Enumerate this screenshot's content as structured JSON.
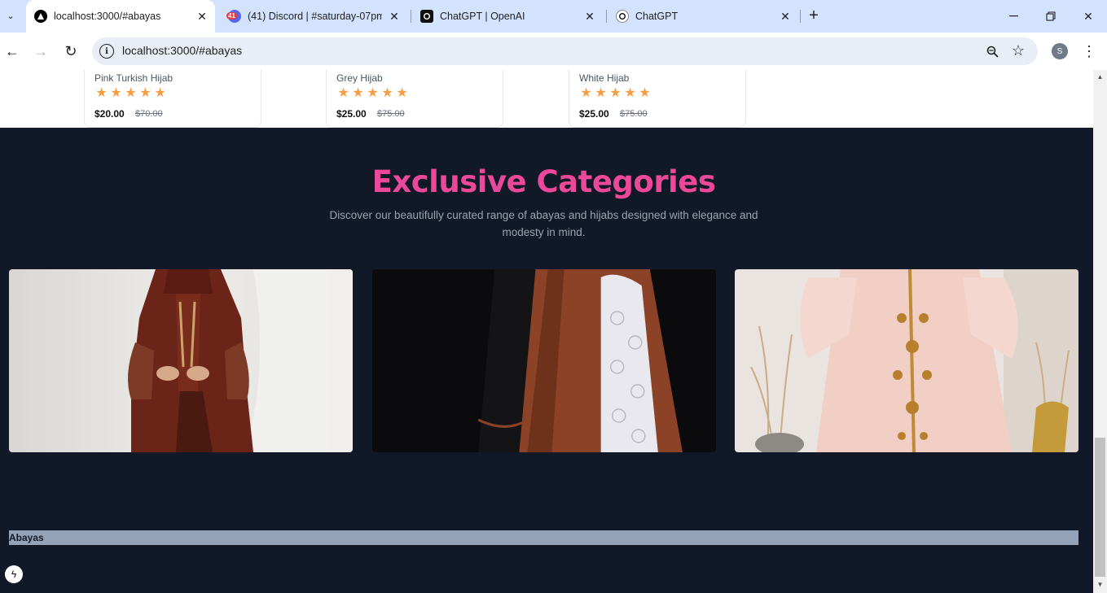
{
  "browser": {
    "tabs": [
      {
        "title": "localhost:3000/#abayas",
        "active": true
      },
      {
        "title": "(41) Discord | #saturday-07pm |",
        "badge": "41"
      },
      {
        "title": "ChatGPT | OpenAI"
      },
      {
        "title": "ChatGPT"
      }
    ],
    "url": "localhost:3000/#abayas",
    "profile_initial": "S"
  },
  "products": [
    {
      "name": "Pink Turkish Hijab",
      "price": "$20.00",
      "old_price": "$70.00",
      "rating": 5
    },
    {
      "name": "Grey Hijab",
      "price": "$25.00",
      "old_price": "$75.00",
      "rating": 5
    },
    {
      "name": "White Hijab",
      "price": "$25.00",
      "old_price": "$75.00",
      "rating": 5
    }
  ],
  "categories_section": {
    "title": "Exclusive Categories",
    "subtitle": "Discover our beautifully curated range of abayas and hijabs designed with elegance and modesty in mind."
  },
  "footer": {
    "label": "Abayas"
  },
  "colors": {
    "page_bg": "#111827",
    "accent": "#ec4899",
    "star": "#f59e42",
    "footer_bar": "#94a3b8",
    "tab_strip": "#d3e3fd"
  },
  "icons": {
    "tab_search": "chevron-down-icon",
    "close": "close-icon",
    "new_tab": "plus-icon",
    "back": "back-arrow-icon",
    "forward": "forward-arrow-icon",
    "reload": "reload-icon",
    "site_info": "info-icon",
    "zoom": "zoom-icon",
    "bookmark": "star-outline-icon",
    "menu": "kebab-menu-icon",
    "next_badge": "lightning-icon"
  }
}
